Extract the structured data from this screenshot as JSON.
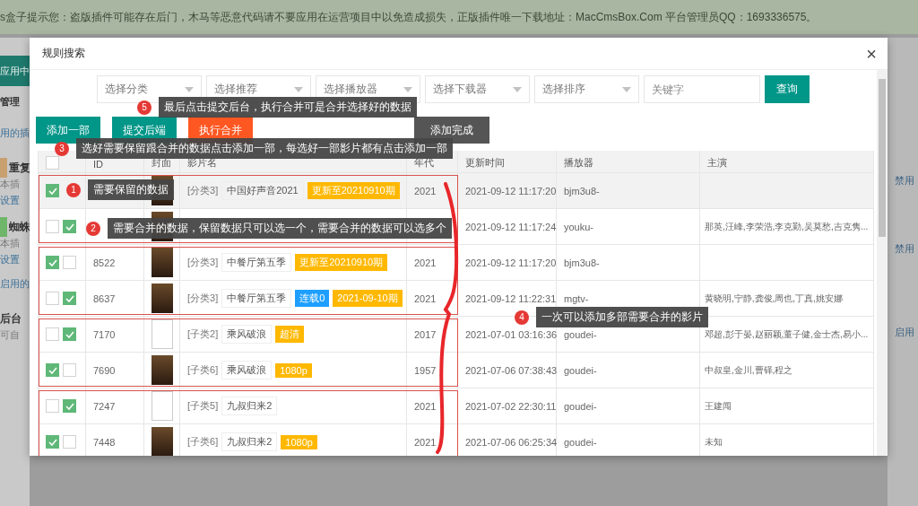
{
  "notice": "s盒子提示您：盗版插件可能存在后门，木马等恶意代码请不要应用在运营项目中以免造成损失，正版插件唯一下载地址：MacCmsBox.Com 平台管理员QQ：1693336575。",
  "sidebar": {
    "items": [
      {
        "text": "应用中",
        "kind": "tab"
      },
      {
        "text": "管理",
        "kind": "heading"
      },
      {
        "text": "用的插",
        "kind": "section"
      },
      {
        "text": "重复",
        "kind": "title",
        "color": "#c8a070"
      },
      {
        "text": "本插",
        "kind": "desc"
      },
      {
        "text": "设置",
        "kind": "link"
      },
      {
        "text": "蜘蛛",
        "kind": "title",
        "color": "#6fb56a"
      },
      {
        "text": "本插",
        "kind": "desc"
      },
      {
        "text": "设置",
        "kind": "link"
      },
      {
        "text": "启用的",
        "kind": "section"
      },
      {
        "text": "后台",
        "kind": "title"
      },
      {
        "text": "可自",
        "kind": "desc"
      }
    ]
  },
  "right_links": [
    "禁用",
    "禁用",
    "启用"
  ],
  "dialog": {
    "title": "规则搜索",
    "close": "×",
    "filters": [
      {
        "label": "选择分类"
      },
      {
        "label": "选择推荐"
      },
      {
        "label": "选择播放器"
      },
      {
        "label": "选择下载器"
      },
      {
        "label": "选择排序"
      }
    ],
    "keyword": {
      "placeholder": "关键字"
    },
    "search_button": "查询",
    "actions": [
      {
        "label": "添加一部",
        "kind": "primary"
      },
      {
        "label": "提交后端",
        "kind": "primary"
      },
      {
        "label": "执行合并",
        "kind": "danger"
      },
      {
        "label": "添加完成",
        "kind": "dark"
      }
    ],
    "table": {
      "header_checkbox": {
        "checked": false
      },
      "columns": [
        "ID",
        "封面",
        "影片名",
        "年代",
        "更新时间",
        "播放器",
        "主演"
      ],
      "groups": [
        {
          "rows": [
            {
              "hovered": true,
              "checks": [
                {
                  "checked": true
                }
              ],
              "cover": {
                "kind": "photo"
              },
              "category": "[分类3]",
              "title": "中国好声音2021",
              "badges": [
                {
                  "text": "更新至20210910期",
                  "color": "#ffb800"
                }
              ],
              "year": "2021",
              "updated": "2021-09-12 11:17:20",
              "player": "bjm3u8-"
            },
            {
              "hovered": false,
              "checks": [
                {
                  "checked": false
                },
                {
                  "checked": true
                }
              ],
              "cover": {
                "kind": "photo"
              },
              "updated": "2021-09-12 11:17:24",
              "player": "youku-",
              "actors": "那英,汪峰,李荣浩,李克勤,吴莫愁,吉克隽..."
            }
          ]
        },
        {
          "rows": [
            {
              "hovered": false,
              "checks": [
                {
                  "checked": true
                },
                {
                  "checked": false
                }
              ],
              "id": "8522",
              "cover": {
                "kind": "photo"
              },
              "category": "[分类3]",
              "title": "中餐厅第五季",
              "badges": [
                {
                  "text": "更新至20210910期",
                  "color": "#ffb800"
                }
              ],
              "year": "2021",
              "updated": "2021-09-12 11:17:20",
              "player": "bjm3u8-"
            },
            {
              "hovered": false,
              "checks": [
                {
                  "checked": false
                },
                {
                  "checked": true
                }
              ],
              "id": "8637",
              "cover": {
                "kind": "photo"
              },
              "category": "[分类3]",
              "title": "中餐厅第五季",
              "badges": [
                {
                  "text": "连载0",
                  "color": "#1e9fff"
                },
                {
                  "text": "2021-09-10期",
                  "color": "#ffb800"
                }
              ],
              "year": "2021",
              "updated": "2021-09-12 11:22:31",
              "player": "mgtv-",
              "actors": "黄晓明,宁静,龚俊,周也,丁真,姚安娜"
            }
          ]
        },
        {
          "rows": [
            {
              "hovered": false,
              "checks": [
                {
                  "checked": false
                },
                {
                  "checked": true
                }
              ],
              "id": "7170",
              "cover": {
                "kind": "broken"
              },
              "category": "[子类2]",
              "title": "乘风破浪",
              "badges": [
                {
                  "text": "超清",
                  "color": "#ffb800"
                }
              ],
              "year": "2017",
              "updated": "2021-07-01 03:16:36",
              "player": "goudei-",
              "actors": "邓超,彭于晏,赵丽颖,董子健,金士杰,易小..."
            },
            {
              "hovered": false,
              "checks": [
                {
                  "checked": true
                },
                {
                  "checked": false
                }
              ],
              "id": "7690",
              "cover": {
                "kind": "photo"
              },
              "category": "[子类6]",
              "title": "乘风破浪",
              "badges": [
                {
                  "text": "1080p",
                  "color": "#ffb800"
                }
              ],
              "year": "1957",
              "updated": "2021-07-06 07:38:43",
              "player": "goudei-",
              "actors": "中叔皇,金川,曹铎,程之"
            }
          ]
        },
        {
          "rows": [
            {
              "hovered": false,
              "checks": [
                {
                  "checked": false
                },
                {
                  "checked": true
                }
              ],
              "id": "7247",
              "cover": {
                "kind": "broken"
              },
              "category": "[子类5]",
              "title": "九叔归来2",
              "badges": [],
              "year": "2021",
              "updated": "2021-07-02 22:30:11",
              "player": "goudei-",
              "actors": "王建闯"
            },
            {
              "hovered": false,
              "checks": [
                {
                  "checked": true
                },
                {
                  "checked": false
                }
              ],
              "id": "7448",
              "cover": {
                "kind": "photo"
              },
              "category": "[子类6]",
              "title": "九叔归来2",
              "badges": [
                {
                  "text": "1080p",
                  "color": "#ffb800"
                }
              ],
              "year": "2021",
              "updated": "2021-07-06 06:25:34",
              "player": "goudei-",
              "actors": "未知"
            }
          ]
        }
      ]
    },
    "annotations": [
      {
        "number": "5",
        "text": "最后点击提交后台，执行合并可是合并选择好的数据"
      },
      {
        "number": "3",
        "text": "选好需要保留跟合并的数据点击添加一部，每选好一部影片都有点击添加一部"
      },
      {
        "number": "1",
        "text": "需要保留的数据"
      },
      {
        "number": "2",
        "text": "需要合并的数据，保留数据只可以选一个，需要合并的数据可以选多个"
      },
      {
        "number": "4",
        "text": "一次可以添加多部需要合并的影片"
      }
    ]
  }
}
